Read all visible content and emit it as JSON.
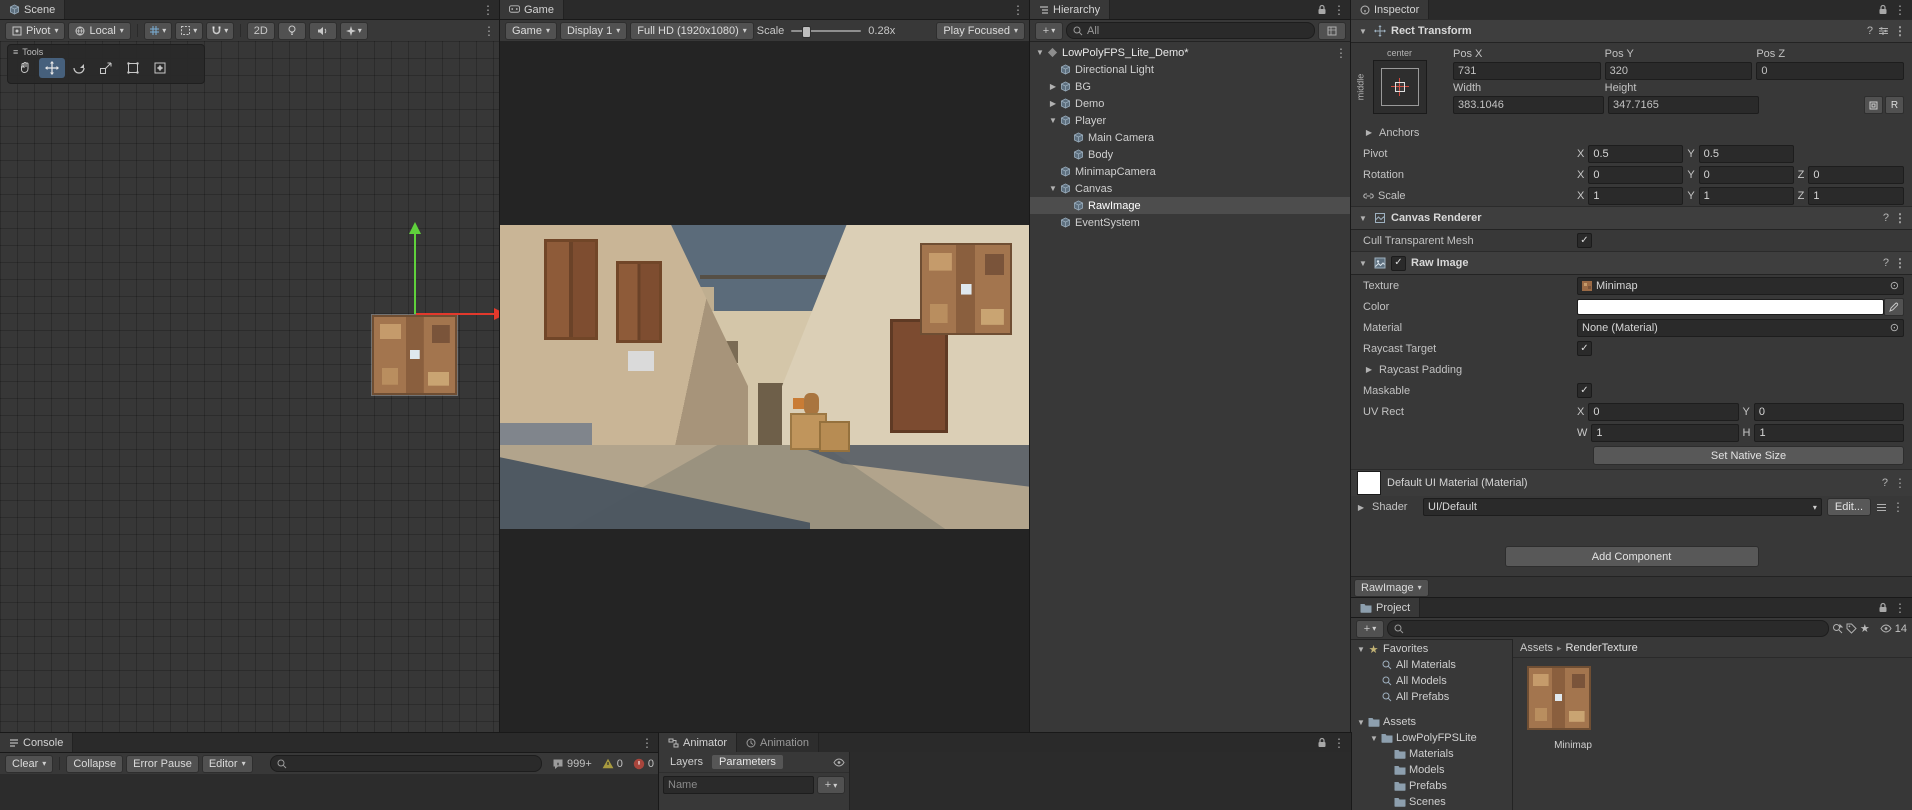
{
  "colors": {
    "selection_gray": "#4d4d4d",
    "tool_active_blue": "#46607c",
    "gizmo_green": "#5fd13c",
    "gizmo_red": "#e3392c",
    "panel_bg": "#383838"
  },
  "scene": {
    "tab": "Scene",
    "pivot": "Pivot",
    "local": "Local",
    "two_d": "2D",
    "tools_title": "Tools"
  },
  "game": {
    "tab": "Game",
    "menu": "Game",
    "display": "Display 1",
    "resolution": "Full HD (1920x1080)",
    "scale_label": "Scale",
    "scale_value": "0.28x",
    "play_focused": "Play Focused"
  },
  "hierarchy": {
    "tab": "Hierarchy",
    "search_text": "All",
    "items": [
      {
        "label": "LowPolyFPS_Lite_Demo*",
        "level": 0,
        "arrow": "down",
        "type": "scene"
      },
      {
        "label": "Directional Light",
        "level": 1
      },
      {
        "label": "BG",
        "level": 1,
        "arrow": "right"
      },
      {
        "label": "Demo",
        "level": 1,
        "arrow": "right"
      },
      {
        "label": "Player",
        "level": 1,
        "arrow": "down"
      },
      {
        "label": "Main Camera",
        "level": 2
      },
      {
        "label": "Body",
        "level": 2
      },
      {
        "label": "MinimapCamera",
        "level": 1
      },
      {
        "label": "Canvas",
        "level": 1,
        "arrow": "down"
      },
      {
        "label": "RawImage",
        "level": 2,
        "selected": true
      },
      {
        "label": "EventSystem",
        "level": 1
      }
    ]
  },
  "inspector": {
    "tab": "Inspector",
    "rect_transform": {
      "title": "Rect Transform",
      "anchor_h": "center",
      "anchor_v": "middle",
      "pos_x_label": "Pos X",
      "pos_y_label": "Pos Y",
      "pos_z_label": "Pos Z",
      "pos_x": "731",
      "pos_y": "320",
      "pos_z": "0",
      "width_label": "Width",
      "height_label": "Height",
      "width": "383.1046",
      "height": "347.7165",
      "raw_edit": "R",
      "anchors": "Anchors",
      "pivot": "Pivot",
      "pivot_x": "0.5",
      "pivot_y": "0.5",
      "rotation": "Rotation",
      "rot_x": "0",
      "rot_y": "0",
      "rot_z": "0",
      "scale": "Scale",
      "scale_x": "1",
      "scale_y": "1",
      "scale_z": "1",
      "x": "X",
      "y": "Y",
      "z": "Z"
    },
    "canvas_renderer": {
      "title": "Canvas Renderer",
      "cull": "Cull Transparent Mesh"
    },
    "raw_image": {
      "title": "Raw Image",
      "texture": "Texture",
      "texture_value": "Minimap",
      "color": "Color",
      "material": "Material",
      "material_value": "None (Material)",
      "raycast_target": "Raycast Target",
      "raycast_padding": "Raycast Padding",
      "maskable": "Maskable",
      "uv_rect": "UV Rect",
      "x": "X",
      "y": "Y",
      "w": "W",
      "h": "H",
      "uv_x": "0",
      "uv_y": "0",
      "uv_w": "1",
      "uv_h": "1",
      "set_native_size": "Set Native Size"
    },
    "material": {
      "title": "Default UI Material (Material)",
      "shader": "Shader",
      "shader_value": "UI/Default",
      "edit": "Edit..."
    },
    "add_component": "Add Component",
    "asset_bar": "RawImage"
  },
  "project": {
    "tab": "Project",
    "hidden_count": "14",
    "breadcrumb_root": "Assets",
    "breadcrumb_current": "RenderTexture",
    "asset_name": "Minimap",
    "tree": [
      {
        "label": "Favorites",
        "level": 0,
        "arrow": "down",
        "type": "star"
      },
      {
        "label": "All Materials",
        "level": 1,
        "type": "search"
      },
      {
        "label": "All Models",
        "level": 1,
        "type": "search"
      },
      {
        "label": "All Prefabs",
        "level": 1,
        "type": "search"
      },
      {
        "label": "Assets",
        "level": 0,
        "arrow": "down",
        "type": "folder",
        "gap": true
      },
      {
        "label": "LowPolyFPSLite",
        "level": 1,
        "arrow": "down",
        "type": "folder"
      },
      {
        "label": "Materials",
        "level": 2,
        "type": "folder"
      },
      {
        "label": "Models",
        "level": 2,
        "type": "folder"
      },
      {
        "label": "Prefabs",
        "level": 2,
        "type": "folder"
      },
      {
        "label": "Scenes",
        "level": 2,
        "type": "folder"
      }
    ]
  },
  "console": {
    "tab": "Console",
    "clear": "Clear",
    "collapse": "Collapse",
    "error_pause": "Error Pause",
    "editor": "Editor",
    "info_count": "999+",
    "warning_count": "0",
    "error_count": "0"
  },
  "animator": {
    "tab_animator": "Animator",
    "tab_animation": "Animation",
    "layers": "Layers",
    "parameters": "Parameters",
    "name_placeholder": "Name"
  }
}
